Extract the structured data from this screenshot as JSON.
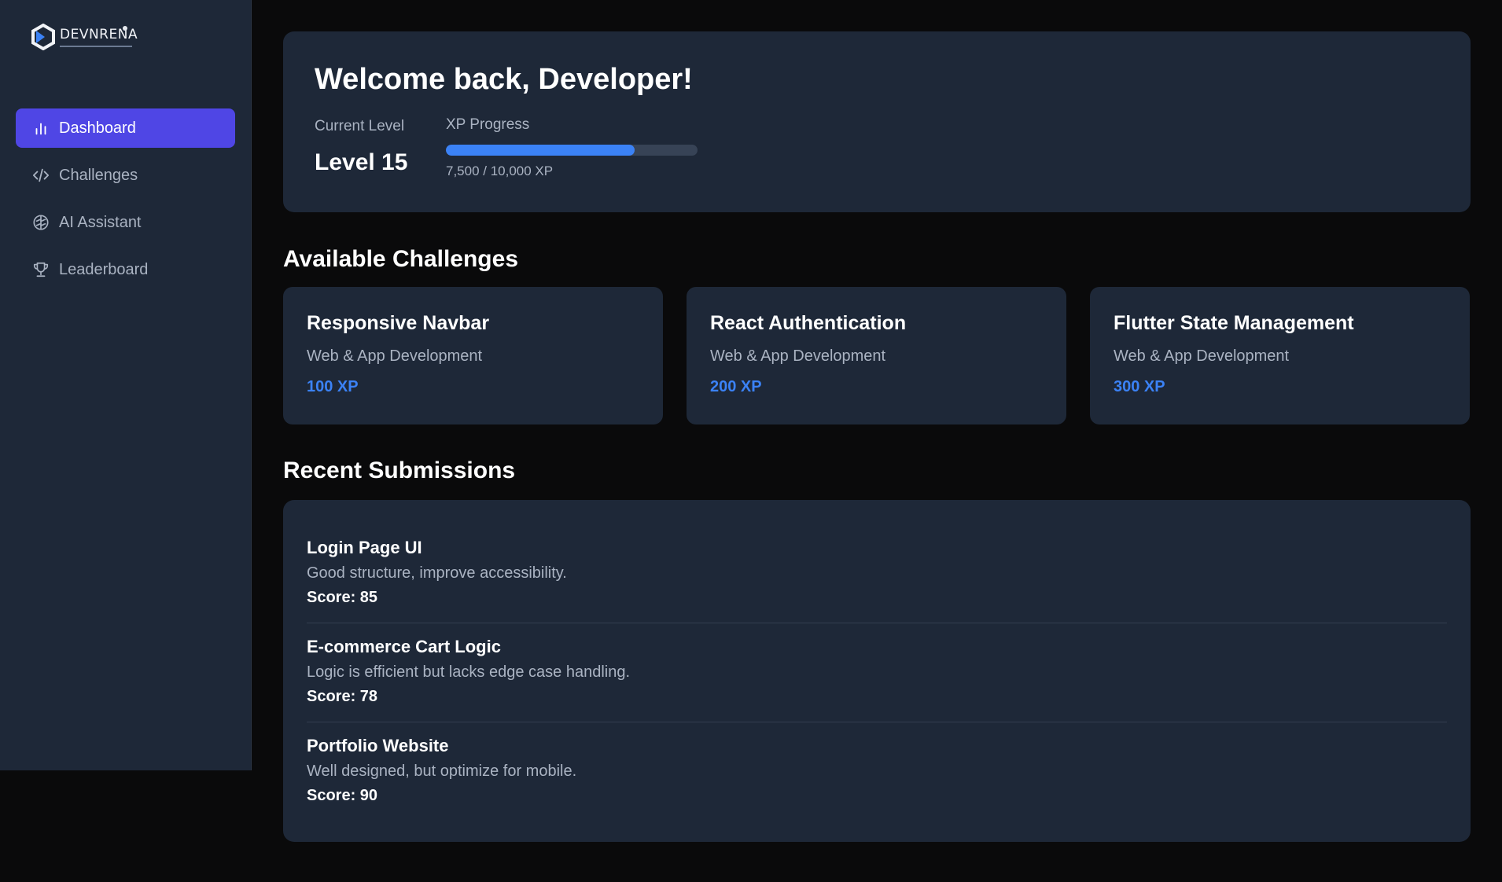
{
  "brand": {
    "name": "DEVNRENA"
  },
  "sidebar": {
    "items": [
      {
        "label": "Dashboard",
        "icon": "bar-chart-icon",
        "active": true
      },
      {
        "label": "Challenges",
        "icon": "code-icon",
        "active": false
      },
      {
        "label": "AI Assistant",
        "icon": "brain-icon",
        "active": false
      },
      {
        "label": "Leaderboard",
        "icon": "trophy-icon",
        "active": false
      }
    ]
  },
  "welcome": {
    "title": "Welcome back, Developer!",
    "level_label": "Current Level",
    "level_value": "Level 15",
    "xp_label": "XP Progress",
    "xp_text": "7,500 / 10,000 XP",
    "xp_current": 7500,
    "xp_max": 10000
  },
  "challenges": {
    "title": "Available Challenges",
    "items": [
      {
        "title": "Responsive Navbar",
        "category": "Web & App Development",
        "xp": "100 XP"
      },
      {
        "title": "React Authentication",
        "category": "Web & App Development",
        "xp": "200 XP"
      },
      {
        "title": "Flutter State Management",
        "category": "Web & App Development",
        "xp": "300 XP"
      }
    ]
  },
  "submissions": {
    "title": "Recent Submissions",
    "items": [
      {
        "title": "Login Page UI",
        "feedback": "Good structure, improve accessibility.",
        "score": "Score: 85"
      },
      {
        "title": "E-commerce Cart Logic",
        "feedback": "Logic is efficient but lacks edge case handling.",
        "score": "Score: 78"
      },
      {
        "title": "Portfolio Website",
        "feedback": "Well designed, but optimize for mobile.",
        "score": "Score: 90"
      }
    ]
  },
  "colors": {
    "accent": "#4f46e5",
    "progress": "#3b82f6",
    "panel": "#1e2838",
    "background": "#0a0a0b"
  }
}
